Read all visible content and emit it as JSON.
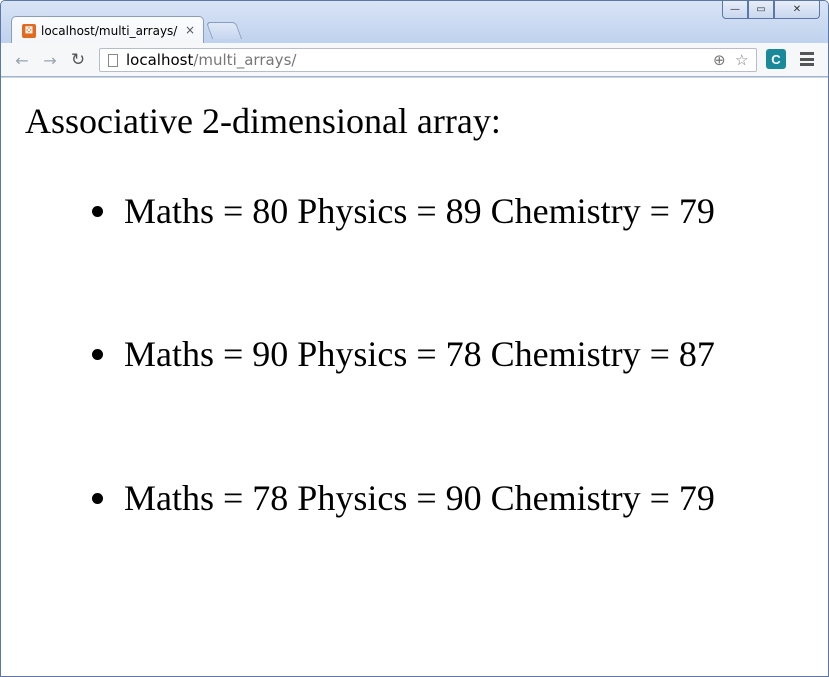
{
  "browser": {
    "tab_title": "localhost/multi_arrays/",
    "tab_close": "×",
    "favicon_glyph": "⊠",
    "url_host": "localhost",
    "url_path": "/multi_arrays/",
    "window_controls": {
      "minimize": "—",
      "maximize": "▭",
      "close": "✕"
    },
    "icons": {
      "back": "back-arrow-icon",
      "forward": "forward-arrow-icon",
      "reload": "reload-icon",
      "page": "page-icon",
      "zoom": "zoom-icon",
      "bookmark": "star-icon",
      "extension": "extension-icon",
      "menu": "menu-icon"
    }
  },
  "page": {
    "heading": "Associative 2-dimensional array:",
    "items": [
      "Maths = 80 Physics = 89 Chemistry = 79",
      "Maths = 90 Physics = 78 Chemistry = 87",
      "Maths = 78 Physics = 90 Chemistry = 79"
    ]
  }
}
